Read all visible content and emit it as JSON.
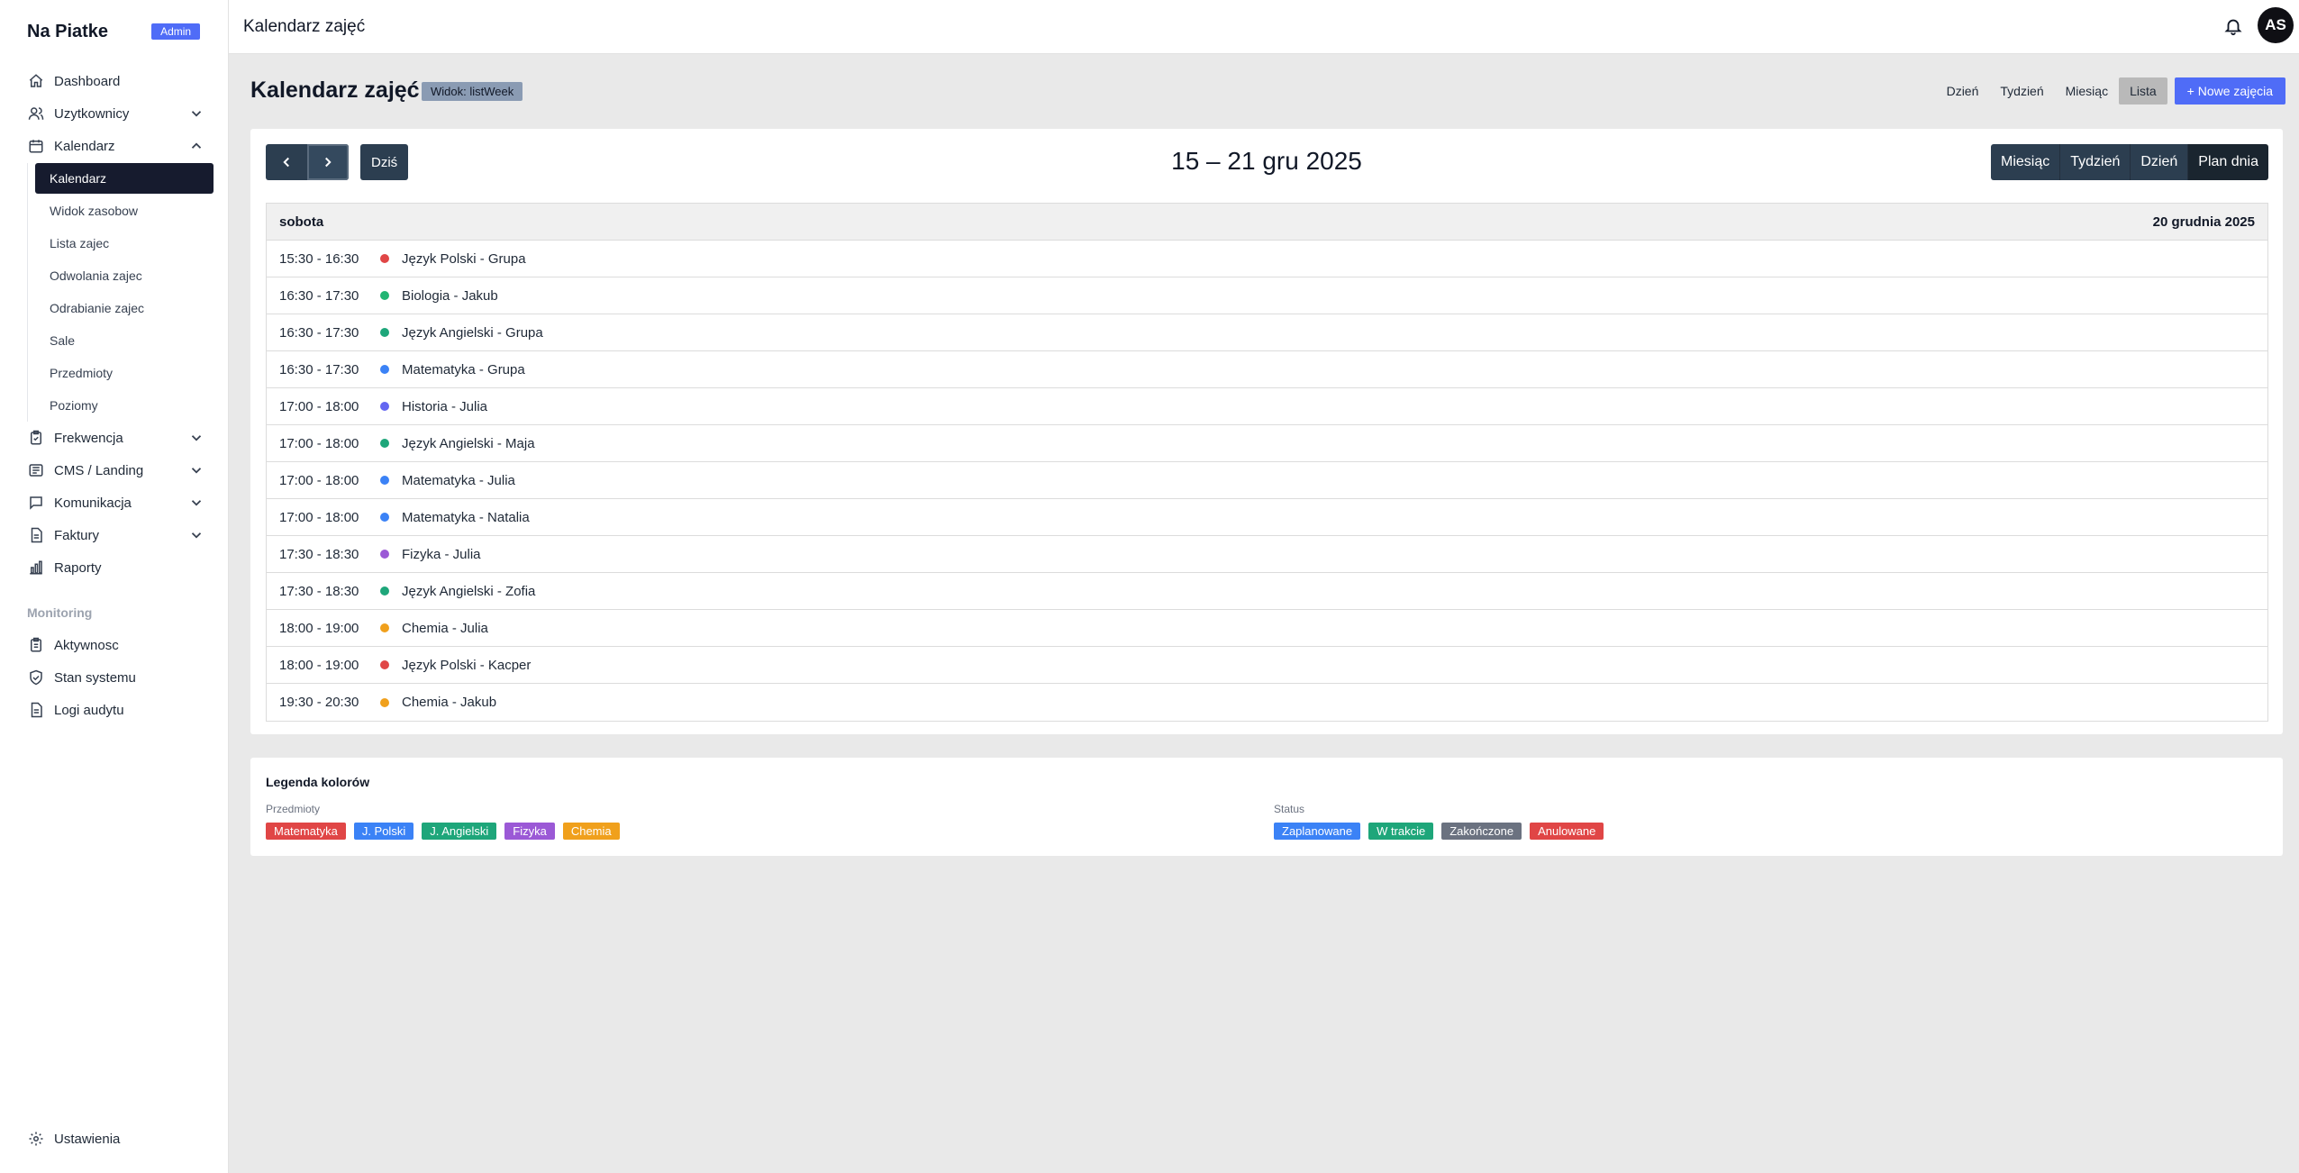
{
  "sidebar": {
    "brand": "Na Piatke",
    "badge": "Admin",
    "items": [
      {
        "label": "Dashboard"
      },
      {
        "label": "Uzytkownicy"
      },
      {
        "label": "Kalendarz"
      }
    ],
    "calendar_sub": [
      {
        "label": "Kalendarz"
      },
      {
        "label": "Widok zasobow"
      },
      {
        "label": "Lista zajec"
      },
      {
        "label": "Odwolania zajec"
      },
      {
        "label": "Odrabianie zajec"
      },
      {
        "label": "Sale"
      },
      {
        "label": "Przedmioty"
      },
      {
        "label": "Poziomy"
      }
    ],
    "items2": [
      {
        "label": "Frekwencja"
      },
      {
        "label": "CMS / Landing"
      },
      {
        "label": "Komunikacja"
      },
      {
        "label": "Faktury"
      },
      {
        "label": "Raporty"
      }
    ],
    "monitoring_label": "Monitoring",
    "monitoring": [
      {
        "label": "Aktywnosc"
      },
      {
        "label": "Stan systemu"
      },
      {
        "label": "Logi audytu"
      }
    ],
    "settings": "Ustawienia"
  },
  "topbar": {
    "title": "Kalendarz zajęć",
    "avatar": "AS"
  },
  "page": {
    "title": "Kalendarz zajęć",
    "view_badge": "Widok: listWeek",
    "views": [
      "Dzień",
      "Tydzień",
      "Miesiąc",
      "Lista"
    ],
    "active_view": "Lista",
    "new_button": "+ Nowe zajęcia"
  },
  "calendar": {
    "today": "Dziś",
    "range": "15 – 21 gru 2025",
    "views": [
      "Miesiąc",
      "Tydzień",
      "Dzień",
      "Plan dnia"
    ],
    "active_view": "Plan dnia",
    "day_label": "sobota",
    "day_date": "20 grudnia 2025",
    "events": [
      {
        "time": "15:30 - 16:30",
        "title": "Język Polski - Grupa",
        "color": "#e04646"
      },
      {
        "time": "16:30 - 17:30",
        "title": "Biologia - Jakub",
        "color": "#22b573"
      },
      {
        "time": "16:30 - 17:30",
        "title": "Język Angielski - Grupa",
        "color": "#1ea67a"
      },
      {
        "time": "16:30 - 17:30",
        "title": "Matematyka - Grupa",
        "color": "#3b82f6"
      },
      {
        "time": "17:00 - 18:00",
        "title": "Historia - Julia",
        "color": "#6366f1"
      },
      {
        "time": "17:00 - 18:00",
        "title": "Język Angielski - Maja",
        "color": "#1ea67a"
      },
      {
        "time": "17:00 - 18:00",
        "title": "Matematyka - Julia",
        "color": "#3b82f6"
      },
      {
        "time": "17:00 - 18:00",
        "title": "Matematyka - Natalia",
        "color": "#3b82f6"
      },
      {
        "time": "17:30 - 18:30",
        "title": "Fizyka - Julia",
        "color": "#9b59d6"
      },
      {
        "time": "17:30 - 18:30",
        "title": "Język Angielski - Zofia",
        "color": "#1ea67a"
      },
      {
        "time": "18:00 - 19:00",
        "title": "Chemia - Julia",
        "color": "#f0a01c"
      },
      {
        "time": "18:00 - 19:00",
        "title": "Język Polski - Kacper",
        "color": "#e04646"
      },
      {
        "time": "19:30 - 20:30",
        "title": "Chemia - Jakub",
        "color": "#f0a01c"
      }
    ]
  },
  "legend": {
    "title": "Legenda kolorów",
    "subjects_label": "Przedmioty",
    "subjects": [
      {
        "label": "Matematyka",
        "color": "#e04646"
      },
      {
        "label": "J. Polski",
        "color": "#3b82f6"
      },
      {
        "label": "J. Angielski",
        "color": "#1ea67a"
      },
      {
        "label": "Fizyka",
        "color": "#9b59d6"
      },
      {
        "label": "Chemia",
        "color": "#f0a01c"
      }
    ],
    "status_label": "Status",
    "statuses": [
      {
        "label": "Zaplanowane",
        "color": "#3b82f6"
      },
      {
        "label": "W trakcie",
        "color": "#1ea67a"
      },
      {
        "label": "Zakończone",
        "color": "#6b7280"
      },
      {
        "label": "Anulowane",
        "color": "#e04646"
      }
    ]
  }
}
